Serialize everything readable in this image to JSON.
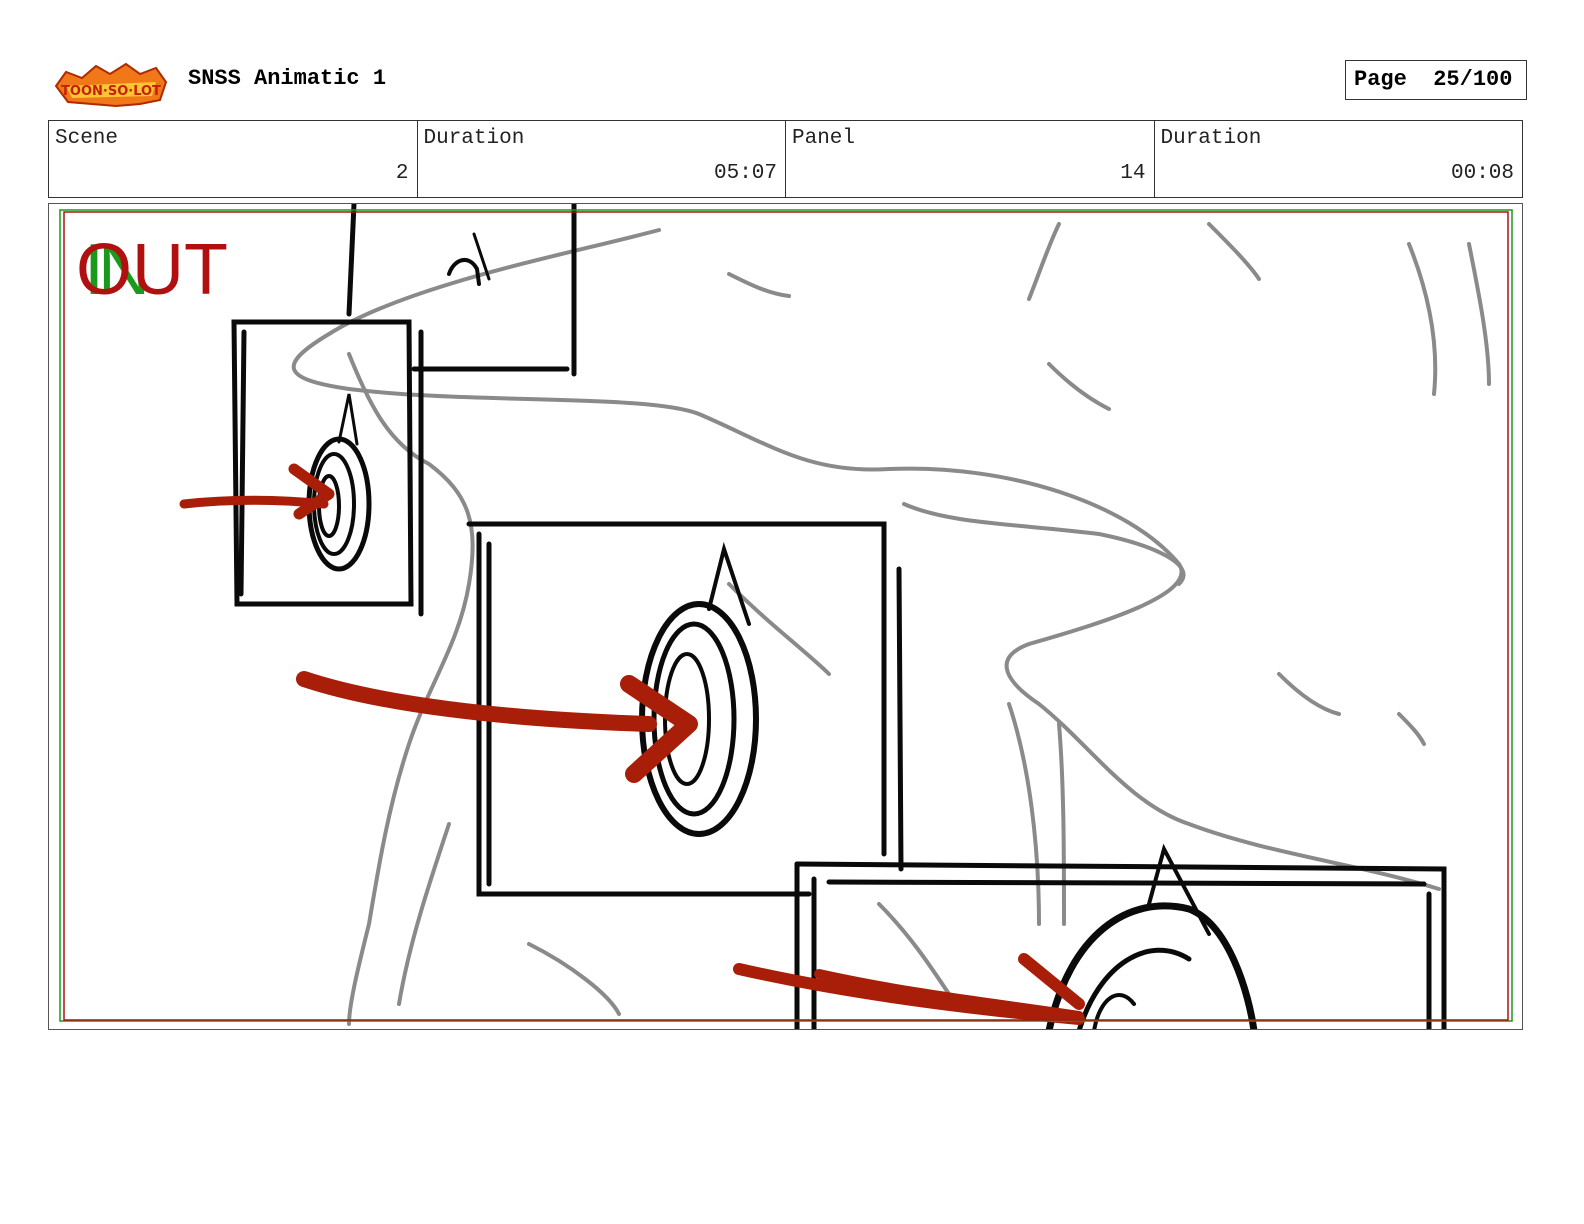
{
  "header": {
    "title": "SNSS Animatic 1",
    "page_label": "Page",
    "page_value": "25/100",
    "logo_text": "Sir Toon-So-Lot"
  },
  "info": {
    "scene_label": "Scene",
    "scene_value": "2",
    "scene_duration_label": "Duration",
    "scene_duration_value": "05:07",
    "panel_label": "Panel",
    "panel_value": "14",
    "panel_duration_label": "Duration",
    "panel_duration_value": "00:08"
  },
  "panel": {
    "in_text": "IN",
    "out_text": "OUT"
  },
  "colors": {
    "safe_area_red": "#b01010",
    "safe_area_green": "#1a9a1a",
    "arrow_red": "#a81e08",
    "sketch_grey": "#888888"
  }
}
